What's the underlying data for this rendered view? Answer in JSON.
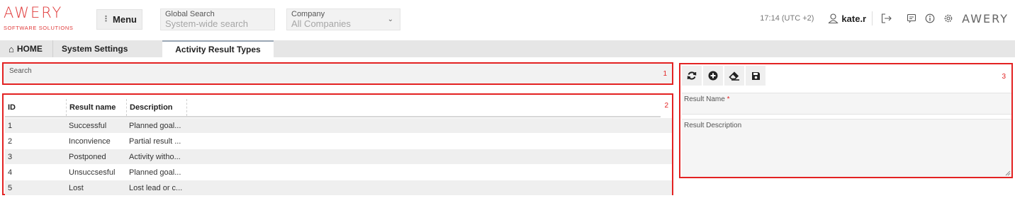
{
  "header": {
    "logo": {
      "word": "AWERY",
      "subtitle": "SOFTWARE SOLUTIONS"
    },
    "menu_label": "Menu",
    "global_search": {
      "label": "Global Search",
      "placeholder": "System-wide search"
    },
    "company": {
      "label": "Company",
      "value": "All Companies"
    },
    "time": "17:14 (UTC +2)",
    "user": "kate.r",
    "brand_right": "AWERY",
    "icons": [
      "user-icon",
      "logout-icon",
      "chat-icon",
      "info-icon",
      "settings-icon"
    ]
  },
  "tabs": [
    {
      "label": "HOME",
      "icon": "home-icon"
    },
    {
      "label": "System Settings"
    },
    {
      "label": "Activity Result Types",
      "active": true
    }
  ],
  "search_panel": {
    "label": "Search",
    "marker": "1"
  },
  "grid": {
    "marker": "2",
    "columns": [
      "ID",
      "Result name",
      "Description"
    ],
    "rows": [
      {
        "id": "1",
        "name": "Successful",
        "description": "Planned goal..."
      },
      {
        "id": "2",
        "name": "Inconvience",
        "description": "Partial result ..."
      },
      {
        "id": "3",
        "name": "Postponed",
        "description": "Activity witho..."
      },
      {
        "id": "4",
        "name": "Unsuccsesful",
        "description": "Planned goal..."
      },
      {
        "id": "5",
        "name": "Lost",
        "description": "Lost lead or c..."
      }
    ]
  },
  "form": {
    "marker": "3",
    "toolbar": [
      "refresh-icon",
      "add-icon",
      "eraser-icon",
      "save-icon"
    ],
    "result_name_label": "Result Name",
    "required_mark": "*",
    "result_description_label": "Result Description"
  },
  "colors": {
    "brand": "#e03a3a",
    "annotation": "#e32222",
    "panel_bg": "#f2f2f2"
  }
}
